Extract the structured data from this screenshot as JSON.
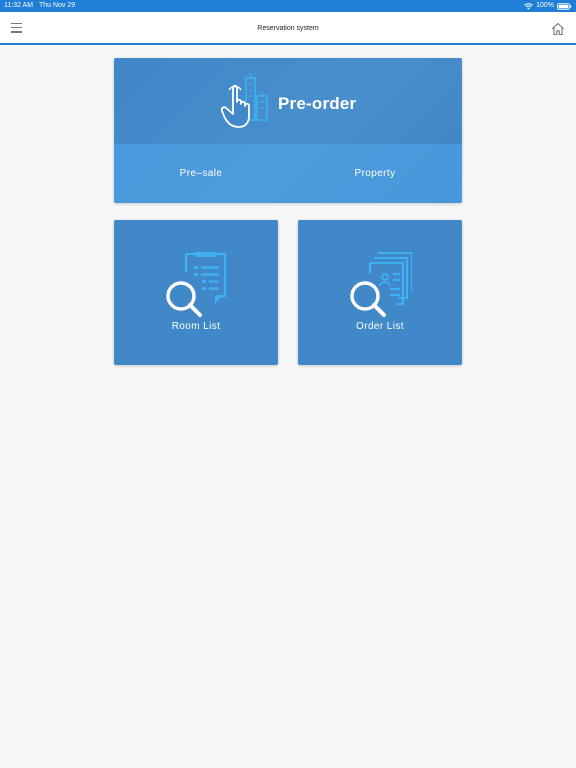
{
  "status_bar": {
    "time": "11:32 AM",
    "date": "Thu Nov 29",
    "battery": "100%",
    "icons": {
      "wifi": "wifi-icon",
      "battery": "battery-icon"
    }
  },
  "nav": {
    "title": "Reservation system",
    "icons": {
      "menu": "menu-icon",
      "home": "home-icon"
    }
  },
  "pre_order": {
    "title": "Pre-order",
    "icon": "hand-buildings-icon",
    "buttons": {
      "presale": "Pre–sale",
      "property": "Property"
    }
  },
  "tiles": {
    "room_list": {
      "label": "Room List",
      "icon": "document-search-icon"
    },
    "order_list": {
      "label": "Order List",
      "icon": "documents-search-icon"
    }
  },
  "colors": {
    "accent": "#1f7fd6",
    "card": "#4088c8",
    "icon_blue": "#3db1f4",
    "background": "#f7f7f7"
  }
}
